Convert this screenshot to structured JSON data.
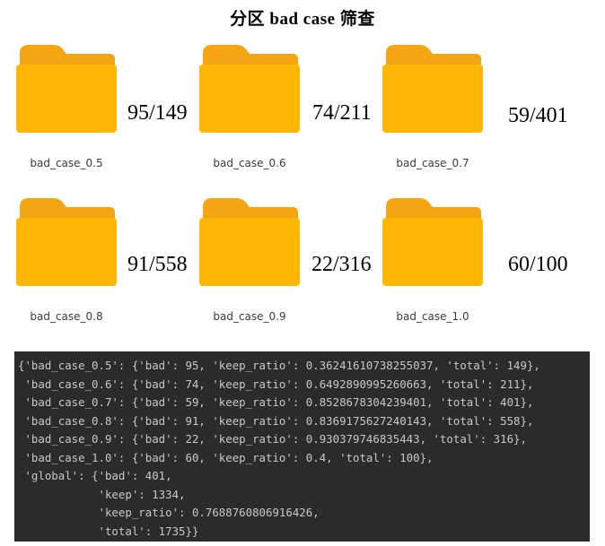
{
  "title": "分区 bad case 筛查",
  "colors": {
    "folder_back": "#F3A512",
    "folder_front": "#FFB703",
    "code_background": "#2B2B2B",
    "code_text": "#C8C8C8"
  },
  "folders": [
    {
      "label": "bad_case_0.5",
      "ratio": "95/149",
      "icon": "folder-icon"
    },
    {
      "label": "bad_case_0.6",
      "ratio": "74/211",
      "icon": "folder-icon"
    },
    {
      "label": "bad_case_0.7",
      "ratio": "59/401",
      "icon": "folder-icon"
    },
    {
      "label": "bad_case_0.8",
      "ratio": "91/558",
      "icon": "folder-icon"
    },
    {
      "label": "bad_case_0.9",
      "ratio": "22/316",
      "icon": "folder-icon"
    },
    {
      "label": "bad_case_1.0",
      "ratio": "60/100",
      "icon": "folder-icon"
    }
  ],
  "code_lines": [
    "{'bad_case_0.5': {'bad': 95, 'keep_ratio': 0.36241610738255037, 'total': 149},",
    " 'bad_case_0.6': {'bad': 74, 'keep_ratio': 0.6492890995260663, 'total': 211},",
    " 'bad_case_0.7': {'bad': 59, 'keep_ratio': 0.8528678304239401, 'total': 401},",
    " 'bad_case_0.8': {'bad': 91, 'keep_ratio': 0.8369175627240143, 'total': 558},",
    " 'bad_case_0.9': {'bad': 22, 'keep_ratio': 0.930379746835443, 'total': 316},",
    " 'bad_case_1.0': {'bad': 60, 'keep_ratio': 0.4, 'total': 100},",
    " 'global': {'bad': 401,",
    "            'keep': 1334,",
    "            'keep_ratio': 0.7688760806916426,",
    "            'total': 1735}}"
  ]
}
